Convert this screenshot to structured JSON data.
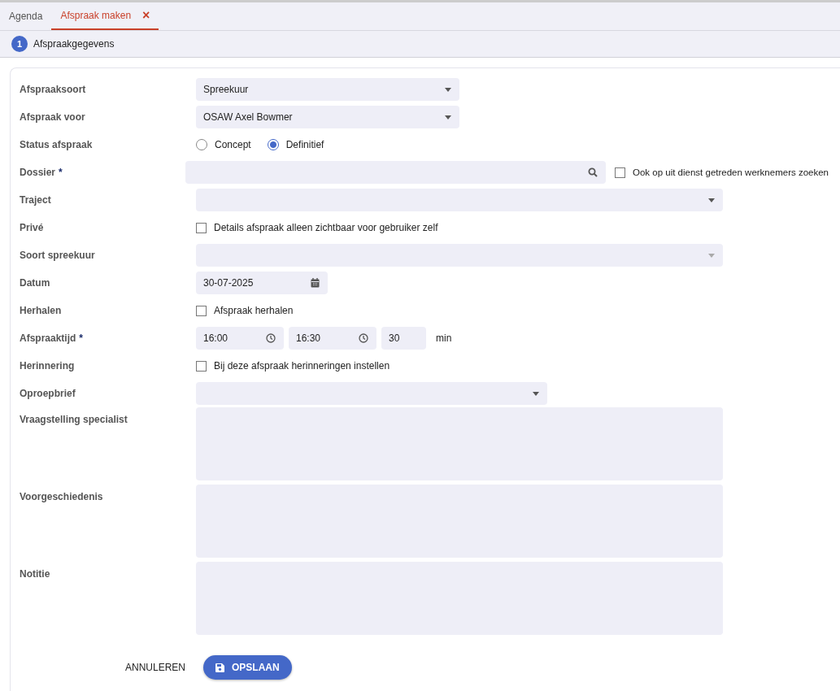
{
  "tabs": [
    {
      "label": "Agenda",
      "selected": false
    },
    {
      "label": "Afspraak maken",
      "selected": true,
      "close": "×"
    }
  ],
  "steps": [
    {
      "number": "1",
      "label": "Afspraakgegevens",
      "selected": true
    }
  ],
  "form": [
    {
      "kind": "select",
      "label": "Afspraaksoort",
      "value": "Spreekuur",
      "disabled": false
    },
    {
      "kind": "select",
      "label": "Afspraak voor",
      "value": "OSAW Axel Bowmer",
      "disabled": false
    },
    {
      "kind": "radio",
      "label": "Status afspraak",
      "options": [
        {
          "label": "Concept",
          "selected": false
        },
        {
          "label": "Definitief",
          "selected": true
        }
      ]
    },
    {
      "kind": "search",
      "label": "Dossier",
      "required": "*",
      "checkbox": {
        "label": "Ook op uit dienst getreden werknemers zoeken",
        "checked": false
      }
    },
    {
      "kind": "select",
      "label": "Traject",
      "disabled": false
    },
    {
      "kind": "checkbox",
      "label": "Privé",
      "checkbox": {
        "label": "Details afspraak alleen zichtbaar voor gebruiker zelf",
        "checked": false
      }
    },
    {
      "kind": "select",
      "label": "Soort spreekuur",
      "disabled": true
    },
    {
      "kind": "date",
      "label": "Datum",
      "value": "30-07-2025"
    },
    {
      "kind": "checkbox",
      "label": "Herhalen",
      "checkbox": {
        "label": "Afspraak herhalen",
        "checked": false
      }
    },
    {
      "kind": "time",
      "label": "Afspraaktijd",
      "required": "*",
      "start": "16:00",
      "end": "16:30",
      "duration": "30",
      "unit": "min"
    },
    {
      "kind": "checkbox",
      "label": "Herinnering",
      "checkbox": {
        "label": "Bij deze afspraak herinneringen instellen",
        "checked": false
      }
    },
    {
      "kind": "select",
      "label": "Oproepbrief",
      "disabled": false
    },
    {
      "kind": "textarea",
      "label": "Vraagstelling specialist"
    },
    {
      "kind": "textarea",
      "label": "Voorgeschiedenis"
    },
    {
      "kind": "textarea",
      "label": "Notitie"
    }
  ],
  "buttons": {
    "cancel": "ANNULEREN",
    "save": "OPSLAAN"
  }
}
